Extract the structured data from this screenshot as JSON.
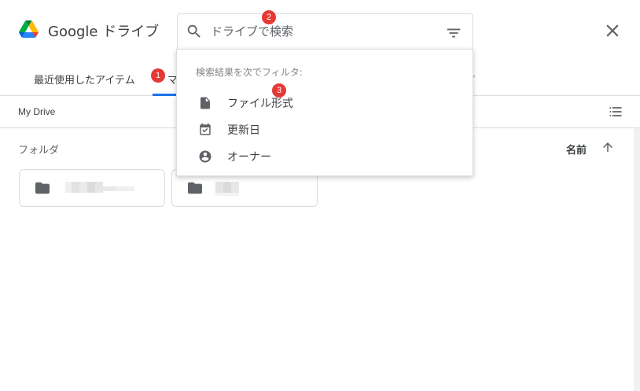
{
  "header": {
    "app_title": "Google ドライブ",
    "close_icon": "close-icon"
  },
  "search": {
    "placeholder": "ドライブで検索",
    "search_icon": "search-icon",
    "filter_icon": "filter-list-icon"
  },
  "tabs": [
    {
      "label": "最近使用したアイテム"
    },
    {
      "label": "マ"
    }
  ],
  "annotations": {
    "badge1": "1",
    "badge2": "2",
    "badge3": "3"
  },
  "breadcrumb": "My Drive",
  "toolbar": {
    "view_icon": "list-view-icon"
  },
  "section": {
    "label": "フォルダ",
    "sort_label": "名前",
    "sort_icon": "arrow-upward-icon"
  },
  "folders": [
    {
      "icon": "folder-icon"
    },
    {
      "icon": "folder-icon"
    }
  ],
  "filter_menu": {
    "heading": "検索結果を次でフィルタ:",
    "items": [
      {
        "label": "ファイル形式",
        "icon": "file-icon"
      },
      {
        "label": "更新日",
        "icon": "calendar-check-icon"
      },
      {
        "label": "オーナー",
        "icon": "account-circle-icon"
      }
    ]
  },
  "colors": {
    "accent": "#1a73e8",
    "badge": "#e53935",
    "icon": "#5f6368",
    "border": "#dadce0"
  }
}
